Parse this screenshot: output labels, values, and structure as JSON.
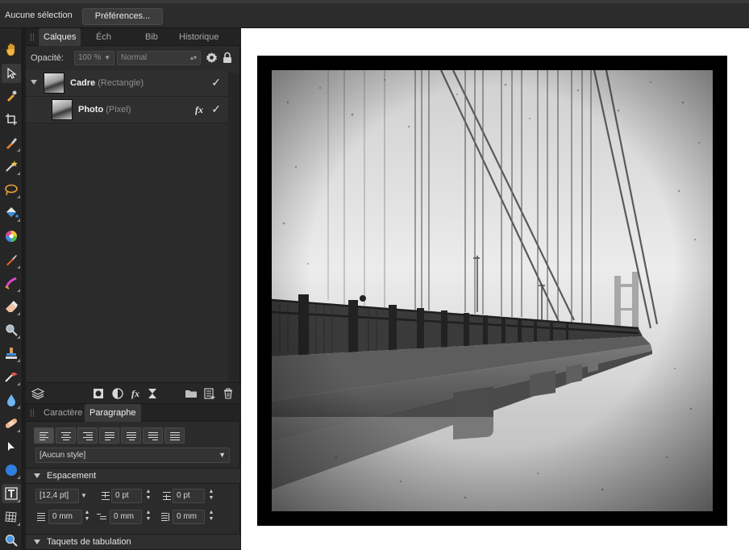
{
  "context_toolbar": {
    "selection_label": "Aucune sélection",
    "preferences_button": "Préférences..."
  },
  "tools": [
    "hand-tool-icon",
    "move-tool-icon",
    "color-picker-icon",
    "crop-tool-icon",
    "paint-brush-icon",
    "magic-wand-icon",
    "lasso-icon",
    "fill-bucket-icon",
    "color-wheel-icon",
    "pixel-brush-icon",
    "gradient-brush-icon",
    "eraser-icon",
    "zoom-icon",
    "clone-stamp-icon",
    "smudge-icon",
    "blur-drop-icon",
    "healing-icon",
    "pointer-icon",
    "shape-icon",
    "text-frame-icon",
    "mesh-warp-icon",
    "view-zoom-icon"
  ],
  "layers_panel": {
    "tabs": [
      "Calques",
      "Éch",
      "Bib",
      "Historique"
    ],
    "active_tab": "Calques",
    "opacity_label": "Opacité:",
    "opacity_value": "100 %",
    "blend_mode": "Normal",
    "layers": [
      {
        "name": "Cadre",
        "kind": "(Rectangle)",
        "visible": true,
        "expanded": true
      },
      {
        "name": "Photo",
        "kind": "(Pixel)",
        "visible": true,
        "has_fx": true
      }
    ],
    "footer_icons": [
      "layers-stack-icon",
      "mask-icon",
      "adjustment-icon",
      "fx-icon",
      "hourglass-icon",
      "group-folder-icon",
      "new-layer-icon",
      "trash-icon"
    ]
  },
  "text_panel": {
    "tabs": [
      "Caractère",
      "Paragraphe"
    ],
    "active_tab": "Paragraphe",
    "alignments": [
      "align-left",
      "align-center",
      "align-right",
      "justify-left",
      "justify-center",
      "justify-right",
      "justify-all"
    ],
    "active_alignment": "align-left",
    "paragraph_style": "[Aucun style]",
    "spacing_section": "Espacement",
    "leading": "[12,4 pt]",
    "space_before": "0 pt",
    "space_after": "0 pt",
    "left_indent": "0 mm",
    "first_line_indent": "0 mm",
    "right_indent": "0 mm",
    "tabs_section": "Taquets de tabulation"
  },
  "document": {
    "frame_color": "#000000",
    "canvas_color": "#ffffff"
  }
}
